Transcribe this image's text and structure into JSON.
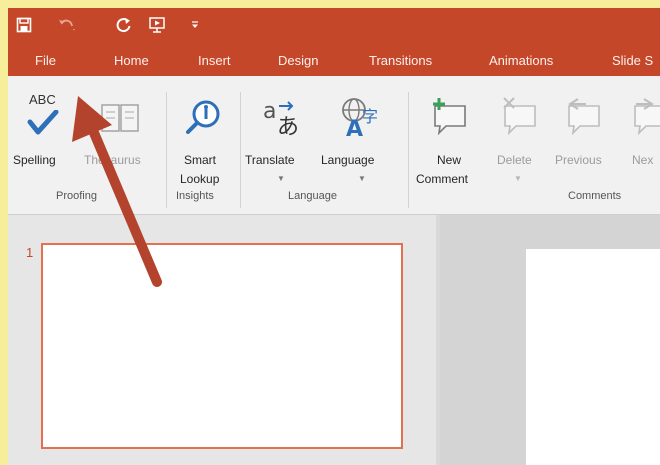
{
  "tabs": [
    "File",
    "Home",
    "Insert",
    "Design",
    "Transitions",
    "Animations",
    "Slide S"
  ],
  "ribbon": {
    "spelling": {
      "icon_text": "ABC",
      "label": "Spelling"
    },
    "thesaurus": {
      "label": "Thesaurus"
    },
    "smart_lookup": {
      "line1": "Smart",
      "line2": "Lookup"
    },
    "translate": {
      "label": "Translate"
    },
    "language": {
      "label": "Language"
    },
    "new_comment": {
      "line1": "New",
      "line2": "Comment"
    },
    "delete": {
      "label": "Delete"
    },
    "previous": {
      "label": "Previous"
    },
    "next": {
      "label": "Nex"
    },
    "groups": {
      "proofing": "Proofing",
      "insights": "Insights",
      "language": "Language",
      "comments": "Comments"
    }
  },
  "slides": {
    "thumb_number": "1"
  },
  "colors": {
    "title_bar": "#c4472a",
    "accent": "#e3714e",
    "annotation_arrow": "#b3432c",
    "page_border": "#f7ee9c"
  },
  "icons": {
    "save": "save-icon",
    "undo": "undo-icon",
    "redo": "redo-icon",
    "start_presentation": "start-from-beginning-icon",
    "customize": "customize-qat-icon"
  }
}
